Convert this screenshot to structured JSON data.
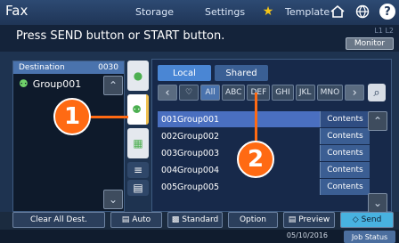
{
  "header": {
    "app_title": "Fax",
    "tabs": [
      {
        "label": "Storage"
      },
      {
        "label": "Settings"
      },
      {
        "label": "Template"
      }
    ]
  },
  "message_bar": {
    "message": "Press SEND button or START button.",
    "lines_indicator": "L1 L2",
    "monitor_label": "Monitor"
  },
  "destination_panel": {
    "header_label": "Destination",
    "count": "0030",
    "items": [
      {
        "label": "Group001"
      }
    ]
  },
  "address_book": {
    "local_tab": "Local",
    "shared_tab": "Shared",
    "index_buttons": [
      {
        "label": "All",
        "icon": "heart-icon"
      },
      {
        "label": "ABC"
      },
      {
        "label": "DEF"
      },
      {
        "label": "GHI"
      },
      {
        "label": "JKL"
      },
      {
        "label": "MNO"
      }
    ],
    "rows": [
      {
        "num": "001",
        "name": "Group001",
        "contents": "Contents",
        "selected": true
      },
      {
        "num": "002",
        "name": "Group002",
        "contents": "Contents",
        "selected": false
      },
      {
        "num": "003",
        "name": "Group003",
        "contents": "Contents",
        "selected": false
      },
      {
        "num": "004",
        "name": "Group004",
        "contents": "Contents",
        "selected": false
      },
      {
        "num": "005",
        "name": "Group005",
        "contents": "Contents",
        "selected": false
      }
    ]
  },
  "callouts": [
    "1",
    "2"
  ],
  "bottom_bar": {
    "clear_all": "Clear All Dest.",
    "auto": "Auto",
    "standard": "Standard",
    "option": "Option",
    "preview": "Preview",
    "send": "Send"
  },
  "status_bar": {
    "date": "05/10/2016",
    "job_status": "Job Status"
  },
  "colors": {
    "accent": "#4a6fc0",
    "callout": "#ff6a13",
    "send": "#48b2e0"
  }
}
